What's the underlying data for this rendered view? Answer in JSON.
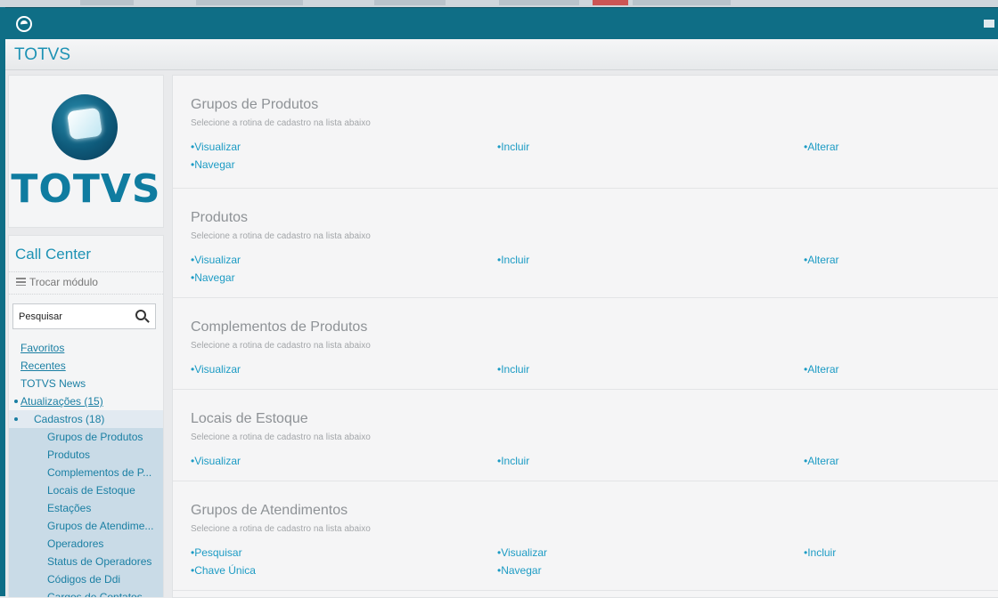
{
  "header": {
    "app_title": "TOTVS",
    "app_icon": "totvs-app-icon",
    "mail_icon": "mail-icon"
  },
  "sidebar": {
    "logo_text": "TOTVS",
    "module_title": "Call Center",
    "switch_module_label": "Trocar módulo",
    "search": {
      "placeholder": "Pesquisar"
    },
    "items": [
      {
        "label": "Favoritos",
        "level": 0
      },
      {
        "label": "Recentes",
        "level": 0
      },
      {
        "label": "TOTVS News",
        "level": 0
      },
      {
        "label": "Atualizações (15)",
        "level": 0
      },
      {
        "label": "Cadastros (18)",
        "level": 1
      },
      {
        "label": "Grupos de Produtos",
        "level": 2
      },
      {
        "label": "Produtos",
        "level": 2
      },
      {
        "label": "Complementos de P...",
        "level": 2
      },
      {
        "label": "Locais de Estoque",
        "level": 2
      },
      {
        "label": "Estações",
        "level": 2
      },
      {
        "label": "Grupos de Atendime...",
        "level": 2
      },
      {
        "label": "Operadores",
        "level": 2
      },
      {
        "label": "Status de Operadores",
        "level": 2
      },
      {
        "label": "Códigos de Ddi",
        "level": 2
      },
      {
        "label": "Cargos de Contatos",
        "level": 2
      }
    ]
  },
  "main": {
    "subtitle": "Selecione a rotina de cadastro na lista abaixo",
    "sections": [
      {
        "title": "Grupos de Produtos",
        "actions": [
          "Visualizar",
          "Incluir",
          "Alterar",
          "Navegar"
        ]
      },
      {
        "title": "Produtos",
        "actions": [
          "Visualizar",
          "Incluir",
          "Alterar",
          "Navegar"
        ]
      },
      {
        "title": "Complementos de Produtos",
        "actions": [
          "Visualizar",
          "Incluir",
          "Alterar"
        ]
      },
      {
        "title": "Locais de Estoque",
        "actions": [
          "Visualizar",
          "Incluir",
          "Alterar"
        ]
      },
      {
        "title": "Grupos de Atendimentos",
        "actions": [
          "Pesquisar",
          "Visualizar",
          "Incluir",
          "Chave Única",
          "Navegar"
        ]
      }
    ]
  }
}
